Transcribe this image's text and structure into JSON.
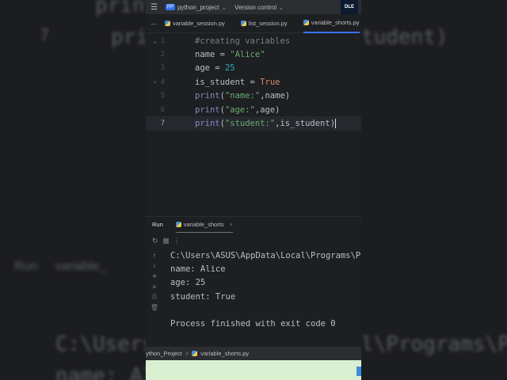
{
  "titlebar": {
    "project_badge": "PP",
    "project": "python_project",
    "version_control": "Version control",
    "logo": "DLE"
  },
  "tabs": [
    {
      "label": "variable_session.py"
    },
    {
      "label": "list_session.py"
    },
    {
      "label": "variable_shorts.py"
    }
  ],
  "editor": {
    "line_numbers": [
      "1",
      "2",
      "3",
      "4",
      "5",
      "6",
      "7"
    ]
  },
  "run": {
    "title": "Run",
    "tab": "variable_shorts",
    "close": "×"
  },
  "console": {
    "lines": [
      "C:\\Users\\ASUS\\AppData\\Local\\Programs\\Py",
      "name: Alice",
      "age: 25",
      "student: True",
      "Process finished with exit code 0"
    ]
  },
  "breadcrumb": {
    "project": "Python_Project",
    "sep": ">",
    "file": "variable_shorts.py"
  }
}
